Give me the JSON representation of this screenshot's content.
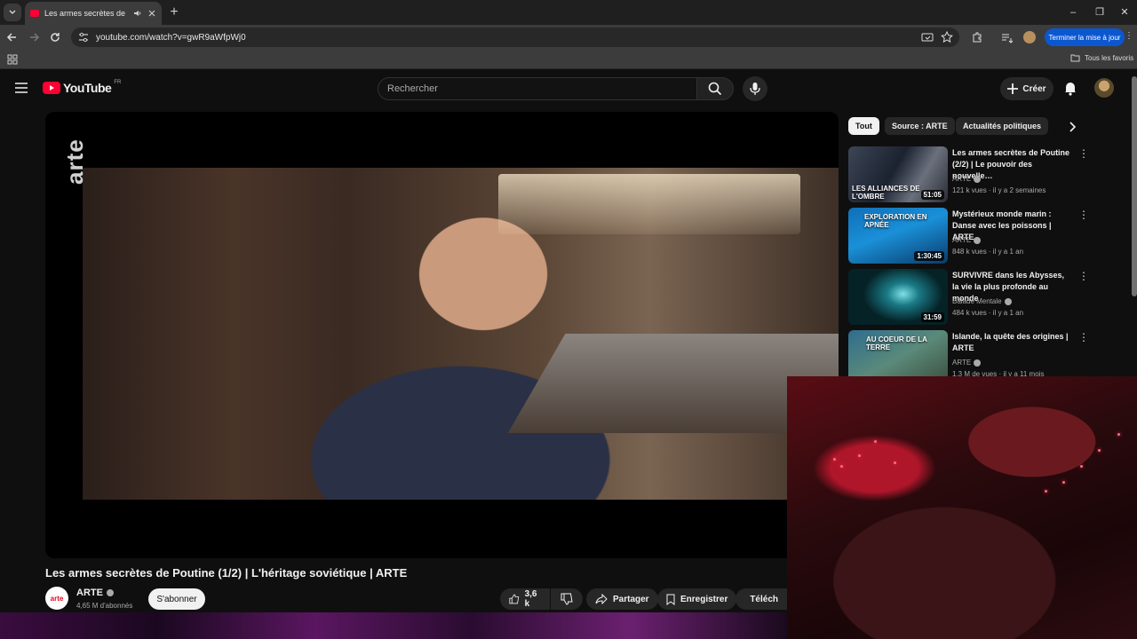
{
  "browser": {
    "tab_title": "Les armes secrètes de Pouti",
    "url": "youtube.com/watch?v=gwR9aWfpWj0",
    "update_button": "Terminer la mise à jour",
    "bookmarks_all": "Tous les favoris"
  },
  "youtube": {
    "logo_text": "YouTube",
    "region": "FR",
    "search_placeholder": "Rechercher",
    "create_label": "Créer"
  },
  "video": {
    "title": "Les armes secrètes de Poutine (1/2) | L'héritage soviétique | ARTE",
    "watermark": "arte",
    "channel_name": "ARTE",
    "channel_logo": "arte",
    "subscribers": "4,65 M d'abonnés",
    "subscribe_label": "S'abonner",
    "likes": "3,6 k",
    "share_label": "Partager",
    "save_label": "Enregistrer",
    "download_label": "Téléch"
  },
  "chips": [
    "Tout",
    "Source : ARTE",
    "Actualités politiques"
  ],
  "recommendations": [
    {
      "title": "Les armes secrètes de Poutine (2/2) | Le pouvoir des nouvelle…",
      "channel": "ARTE",
      "meta": "121 k vues · il y a 2 semaines",
      "duration": "51:05",
      "thumb_text": "LES ALLIANCES DE L'OMBRE"
    },
    {
      "title": "Mystérieux monde marin : Danse avec les poissons | ARTE",
      "channel": "ARTE",
      "meta": "848 k vues · il y a 1 an",
      "duration": "1:30:45",
      "thumb_text": "EXPLORATION EN APNÉE"
    },
    {
      "title": "SURVIVRE dans les Abysses, la vie la plus profonde au monde",
      "channel": "Balade Mentale",
      "meta": "484 k vues · il y a 1 an",
      "duration": "31:59",
      "thumb_text": ""
    },
    {
      "title": "Islande, la quête des origines | ARTE",
      "channel": "ARTE",
      "meta": "1,3 M de vues · il y a 11 mois",
      "duration": "",
      "thumb_text": "AU COEUR DE LA TERRE"
    }
  ],
  "colors": {
    "background": "#0f0f0f",
    "accent_red": "#ff0033",
    "update_blue": "#0b57d0"
  }
}
